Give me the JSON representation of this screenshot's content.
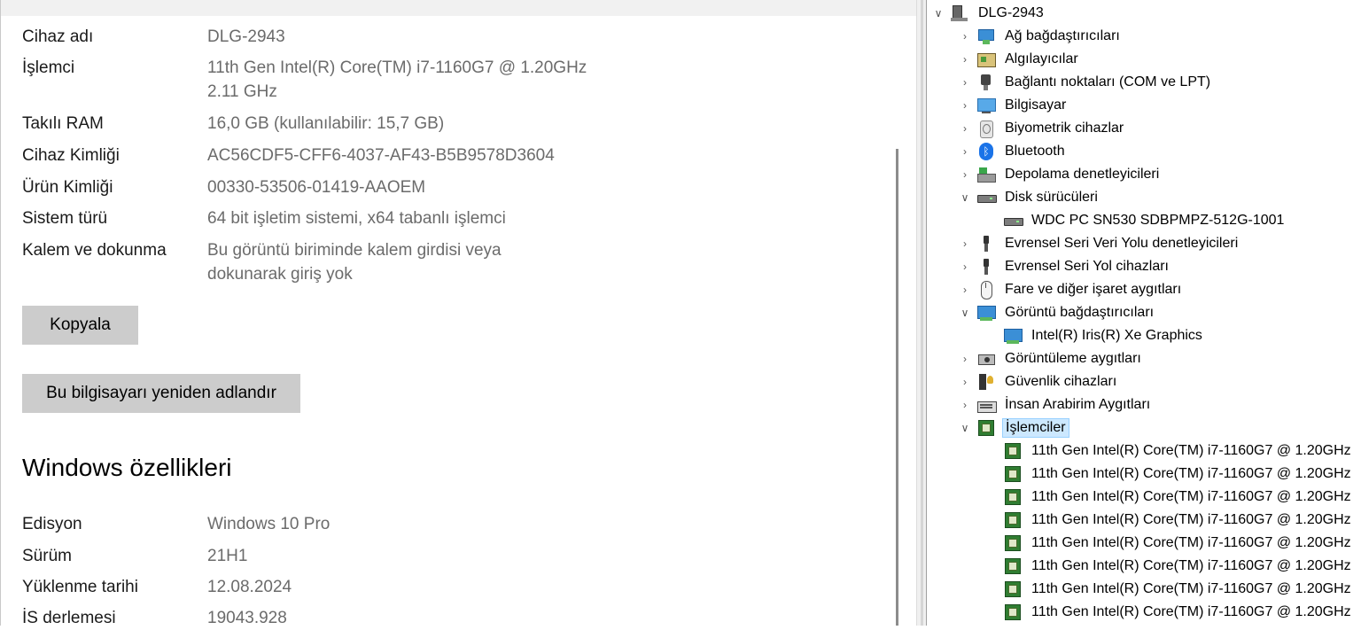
{
  "settings": {
    "specs": [
      {
        "label": "Cihaz adı",
        "value": "DLG-2943"
      },
      {
        "label": "İşlemci",
        "value": "11th Gen Intel(R) Core(TM) i7-1160G7 @ 1.20GHz",
        "value2": "2.11 GHz"
      },
      {
        "label": "Takılı RAM",
        "value": "16,0 GB (kullanılabilir: 15,7 GB)"
      },
      {
        "label": "Cihaz Kimliği",
        "value": "AC56CDF5-CFF6-4037-AF43-B5B9578D3604"
      },
      {
        "label": "Ürün Kimliği",
        "value": "00330-53506-01419-AAOEM"
      },
      {
        "label": "Sistem türü",
        "value": "64 bit işletim sistemi, x64 tabanlı işlemci"
      },
      {
        "label": "Kalem ve dokunma",
        "value": "Bu görüntü biriminde kalem girdisi veya",
        "value2": "dokunarak giriş yok"
      }
    ],
    "copy_label": "Kopyala",
    "rename_label": "Bu bilgisayarı yeniden adlandır",
    "windows_title": "Windows özellikleri",
    "windows_specs": [
      {
        "label": "Edisyon",
        "value": "Windows 10 Pro"
      },
      {
        "label": "Sürüm",
        "value": "21H1"
      },
      {
        "label": "Yüklenme tarihi",
        "value": "12.08.2024"
      },
      {
        "label": "İS derlemesi",
        "value": "19043.928"
      }
    ]
  },
  "device_tree": {
    "root": "DLG-2943",
    "nodes": [
      {
        "label": "Ağ bağdaştırıcıları",
        "icon": "network-adapter-icon"
      },
      {
        "label": "Algılayıcılar",
        "icon": "sensor-icon"
      },
      {
        "label": "Bağlantı noktaları (COM ve LPT)",
        "icon": "port-icon"
      },
      {
        "label": "Bilgisayar",
        "icon": "computer-icon"
      },
      {
        "label": "Biyometrik cihazlar",
        "icon": "biometric-icon"
      },
      {
        "label": "Bluetooth",
        "icon": "bluetooth-icon"
      },
      {
        "label": "Depolama denetleyicileri",
        "icon": "storage-controller-icon"
      },
      {
        "label": "Disk sürücüleri",
        "icon": "disk-drive-icon",
        "expanded": true,
        "children": [
          "WDC PC SN530 SDBPMPZ-512G-1001"
        ]
      },
      {
        "label": "Evrensel Seri Veri Yolu denetleyicileri",
        "icon": "usb-controller-icon"
      },
      {
        "label": "Evrensel Seri Yol cihazları",
        "icon": "usb-device-icon"
      },
      {
        "label": "Fare ve diğer işaret aygıtları",
        "icon": "mouse-icon"
      },
      {
        "label": "Görüntü bağdaştırıcıları",
        "icon": "display-adapter-icon",
        "expanded": true,
        "children": [
          "Intel(R) Iris(R) Xe Graphics"
        ]
      },
      {
        "label": "Görüntüleme aygıtları",
        "icon": "imaging-device-icon"
      },
      {
        "label": "Güvenlik cihazları",
        "icon": "security-device-icon"
      },
      {
        "label": "İnsan Arabirim Aygıtları",
        "icon": "hid-icon"
      },
      {
        "label": "İşlemciler",
        "icon": "processor-icon",
        "expanded": true,
        "selected": true,
        "children": [
          "11th Gen Intel(R) Core(TM) i7-1160G7 @ 1.20GHz",
          "11th Gen Intel(R) Core(TM) i7-1160G7 @ 1.20GHz",
          "11th Gen Intel(R) Core(TM) i7-1160G7 @ 1.20GHz",
          "11th Gen Intel(R) Core(TM) i7-1160G7 @ 1.20GHz",
          "11th Gen Intel(R) Core(TM) i7-1160G7 @ 1.20GHz",
          "11th Gen Intel(R) Core(TM) i7-1160G7 @ 1.20GHz",
          "11th Gen Intel(R) Core(TM) i7-1160G7 @ 1.20GHz",
          "11th Gen Intel(R) Core(TM) i7-1160G7 @ 1.20GHz"
        ]
      }
    ]
  }
}
